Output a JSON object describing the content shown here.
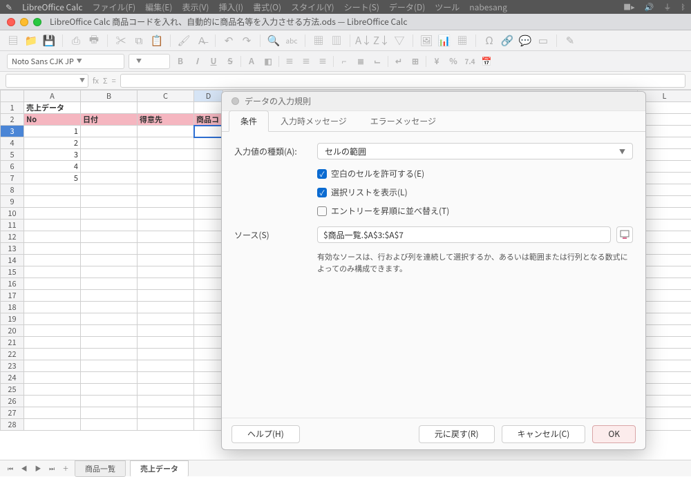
{
  "menubar": {
    "app": "LibreOffice Calc",
    "items": [
      "ファイル(F)",
      "編集(E)",
      "表示(V)",
      "挿入(I)",
      "書式(O)",
      "スタイル(Y)",
      "シート(S)",
      "データ(D)",
      "ツール",
      "nabesang"
    ]
  },
  "titlebar": {
    "title": "LibreOffice Calc 商品コードを入れ、自動的に商品名等を入力させる方法.ods — LibreOffice Calc"
  },
  "font_combo": {
    "name": "Noto Sans CJK JP",
    "size": ""
  },
  "cellref": "",
  "format_pt": "7.4",
  "columns": [
    "A",
    "B",
    "C",
    "D",
    "L"
  ],
  "spreadsheet": {
    "headers": {
      "a1": "売上データ",
      "a2": "No",
      "b2": "日付",
      "c2": "得意先",
      "d2": "商品コ"
    },
    "rows": [
      {
        "n": 1,
        "a": "1"
      },
      {
        "n": 2,
        "a": "2"
      },
      {
        "n": 3,
        "a": "3"
      },
      {
        "n": 4,
        "a": "4"
      },
      {
        "n": 5,
        "a": "5"
      }
    ]
  },
  "dialog": {
    "title": "データの入力規則",
    "tabs": {
      "t1": "条件",
      "t2": "入力時メッセージ",
      "t3": "エラーメッセージ"
    },
    "allow_label": "入力値の種類(A):",
    "allow_value": "セルの範囲",
    "chk_blank": "空白のセルを許可する(E)",
    "chk_list": "選択リストを表示(L)",
    "chk_sort": "エントリーを昇順に並べ替え(T)",
    "source_label": "ソース(S)",
    "source_value": "$商品一覧.$A$3:$A$7",
    "hint": "有効なソースは、行および列を連続して選択するか、あるいは範囲または行列となる数式によってのみ構成できます。",
    "buttons": {
      "help": "ヘルプ(H)",
      "reset": "元に戻す(R)",
      "cancel": "キャンセル(C)",
      "ok": "OK"
    }
  },
  "tabs": {
    "t1": "商品一覧",
    "t2": "売上データ"
  }
}
